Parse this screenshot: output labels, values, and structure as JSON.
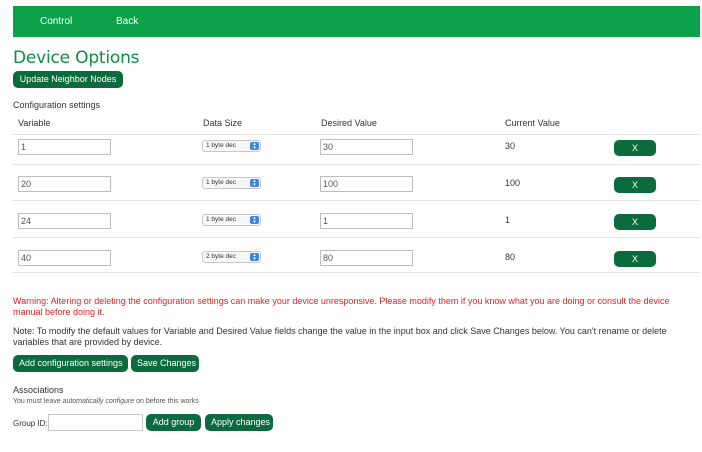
{
  "nav": {
    "control": "Control",
    "back": "Back"
  },
  "page_title": "Device Options",
  "update_neighbor_label": "Update Neighbor Nodes",
  "config": {
    "section_label": "Configuration settings",
    "headers": {
      "variable": "Variable",
      "data_size": "Data Size",
      "desired": "Desired Value",
      "current": "Current Value"
    },
    "rows": [
      {
        "variable": "1",
        "data_size": "1 byte dec",
        "desired": "30",
        "current": "30",
        "delete": "X"
      },
      {
        "variable": "20",
        "data_size": "1 byte dec",
        "desired": "100",
        "current": "100",
        "delete": "X"
      },
      {
        "variable": "24",
        "data_size": "1 byte dec",
        "desired": "1",
        "current": "1",
        "delete": "X"
      },
      {
        "variable": "40",
        "data_size": "2 byte dec",
        "desired": "80",
        "current": "80",
        "delete": "X"
      }
    ]
  },
  "warning": "Warning: Altering or deleting the configuration settings can make your device unresponsive. Please modify them if you know what you are doing or consult the device manual before doing it.",
  "note": "Note: To modify the default values for Variable and Desired Value fields change the value in the input box and click Save Changes below. You can't rename or delete variables that are provided by device.",
  "buttons": {
    "add_config": "Add configuration settings",
    "save_changes": "Save Changes",
    "add_group": "Add group",
    "apply_changes": "Apply changes"
  },
  "associations": {
    "label": "Associations",
    "hint_pre": "You must leave ",
    "hint_em": "automatically configure",
    "hint_post": " on before this works",
    "group_id_label": "Group ID:",
    "group_id_value": ""
  },
  "colors": {
    "nav_green": "#0ca24a",
    "button_green": "#0c6b3e",
    "title_green": "#0a8f43",
    "warning_red": "#e31f1f"
  }
}
